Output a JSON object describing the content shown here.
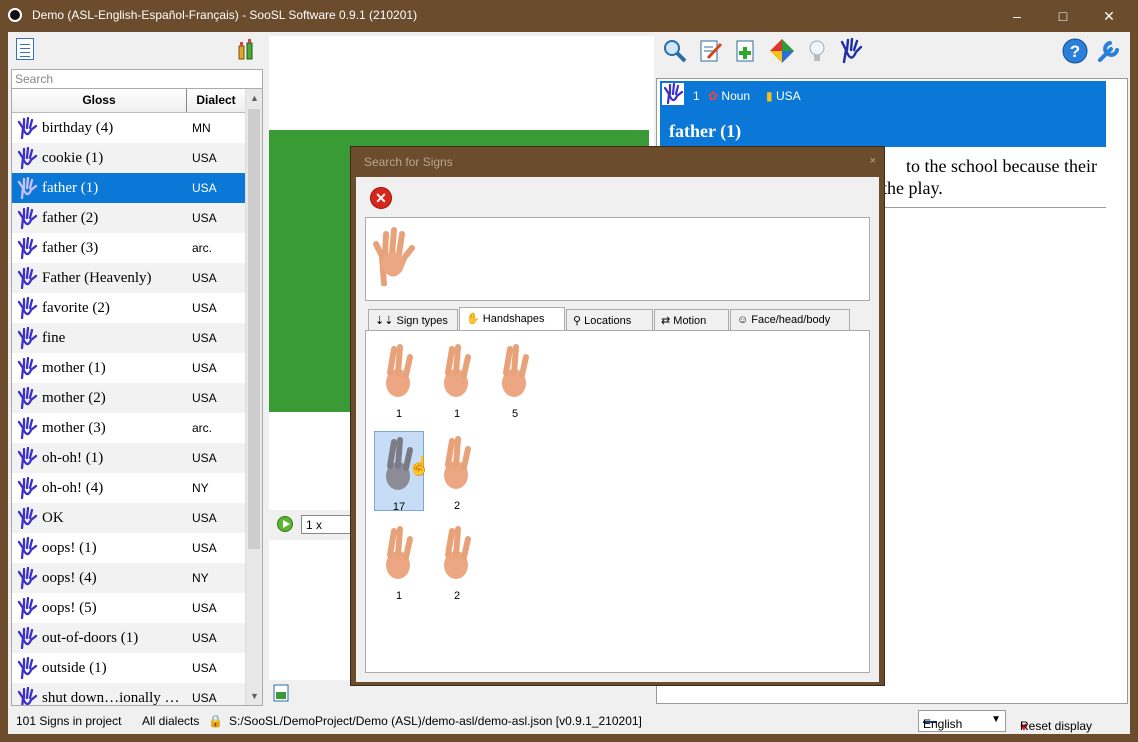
{
  "window": {
    "title": "Demo (ASL-English-Español-Français) - SooSL Software 0.9.1 (210201)",
    "minimize": "–",
    "maximize": "□",
    "close": "✕"
  },
  "left": {
    "search_placeholder": "Search",
    "columns": {
      "gloss": "Gloss",
      "dialect": "Dialect"
    },
    "rows": [
      {
        "gloss": "birthday (4)",
        "dialect": "MN"
      },
      {
        "gloss": "cookie (1)",
        "dialect": "USA"
      },
      {
        "gloss": "father (1)",
        "dialect": "USA",
        "selected": true
      },
      {
        "gloss": "father (2)",
        "dialect": "USA"
      },
      {
        "gloss": "father (3)",
        "dialect": "arc."
      },
      {
        "gloss": "Father (Heavenly)",
        "dialect": "USA"
      },
      {
        "gloss": "favorite (2)",
        "dialect": "USA"
      },
      {
        "gloss": "fine",
        "dialect": "USA"
      },
      {
        "gloss": "mother (1)",
        "dialect": "USA"
      },
      {
        "gloss": "mother (2)",
        "dialect": "USA"
      },
      {
        "gloss": "mother (3)",
        "dialect": "arc."
      },
      {
        "gloss": "oh-oh! (1)",
        "dialect": "USA"
      },
      {
        "gloss": "oh-oh! (4)",
        "dialect": "NY"
      },
      {
        "gloss": "OK",
        "dialect": "USA"
      },
      {
        "gloss": "oops! (1)",
        "dialect": "USA"
      },
      {
        "gloss": "oops! (4)",
        "dialect": "NY"
      },
      {
        "gloss": "oops! (5)",
        "dialect": "USA"
      },
      {
        "gloss": "out-of-doors (1)",
        "dialect": "USA"
      },
      {
        "gloss": "outside (1)",
        "dialect": "USA"
      },
      {
        "gloss": "shut down…ionally …",
        "dialect": "USA"
      }
    ]
  },
  "middle": {
    "speed": "1 x"
  },
  "right": {
    "entry": {
      "number": "1",
      "part_of_speech": "Noun",
      "dialect": "USA",
      "title": "father (1)",
      "sentence_line1": "to the school because their",
      "sentence_line2": "the play."
    }
  },
  "dialog": {
    "title": "Search for Signs",
    "close": "×",
    "cancel": "✕",
    "tabs": [
      "Sign types",
      "Handshapes",
      "Locations",
      "Motion",
      "Face/head/body"
    ],
    "active_tab": "Handshapes",
    "handshapes": [
      {
        "count": "1"
      },
      {
        "count": "1"
      },
      {
        "count": "5"
      },
      {
        "count": "17",
        "selected": true
      },
      {
        "count": "2"
      },
      {
        "count": "1"
      },
      {
        "count": "2"
      }
    ]
  },
  "status": {
    "signs_count": "101 Signs in project",
    "dialects": "All dialects",
    "path": "S:/SooSL/DemoProject/Demo (ASL)/demo-asl/demo-asl.json [v0.9.1_210201]",
    "language": "English",
    "reset": "Reset display"
  },
  "colors": {
    "frame": "#6b4c2c",
    "selection": "#0b78d7",
    "video_green": "#3a9a36",
    "hand_icon": "#3b2fc9"
  }
}
